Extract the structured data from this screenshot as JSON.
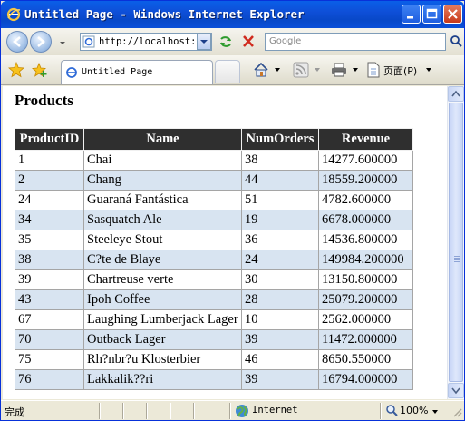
{
  "window": {
    "title": "Untitled Page - Windows Internet Explorer"
  },
  "address_bar": {
    "url": "http://localhost::"
  },
  "search": {
    "placeholder": "Google"
  },
  "tabs": [
    {
      "label": "Untitled Page"
    }
  ],
  "command_bar": {
    "page_label": "页面(P)"
  },
  "page": {
    "heading": "Products",
    "table": {
      "headers": [
        "ProductID",
        "Name",
        "NumOrders",
        "Revenue"
      ],
      "rows": [
        [
          "1",
          "Chai",
          "38",
          "14277.600000"
        ],
        [
          "2",
          "Chang",
          "44",
          "18559.200000"
        ],
        [
          "24",
          "Guaraná Fantástica",
          "51",
          "4782.600000"
        ],
        [
          "34",
          "Sasquatch Ale",
          "19",
          "6678.000000"
        ],
        [
          "35",
          "Steeleye Stout",
          "36",
          "14536.800000"
        ],
        [
          "38",
          "C?te de Blaye",
          "24",
          "149984.200000"
        ],
        [
          "39",
          "Chartreuse verte",
          "30",
          "13150.800000"
        ],
        [
          "43",
          "Ipoh Coffee",
          "28",
          "25079.200000"
        ],
        [
          "67",
          "Laughing Lumberjack Lager",
          "10",
          "2562.000000"
        ],
        [
          "70",
          "Outback Lager",
          "39",
          "11472.000000"
        ],
        [
          "75",
          "Rh?nbr?u Klosterbier",
          "46",
          "8650.550000"
        ],
        [
          "76",
          "Lakkalik??ri",
          "39",
          "16794.000000"
        ]
      ]
    }
  },
  "status_bar": {
    "status": "完成",
    "zone": "Internet",
    "zoom": "100%"
  },
  "colors": {
    "header_bg": "#2f2f2f",
    "alt_row_bg": "#d8e4f1",
    "titlebar": "#0a5fe8"
  },
  "icons": [
    "ie-logo-icon",
    "minimize-icon",
    "maximize-icon",
    "close-icon",
    "back-icon",
    "forward-icon",
    "refresh-icon",
    "stop-icon",
    "search-icon",
    "favorites-star-icon",
    "add-favorites-icon",
    "home-icon",
    "feeds-icon",
    "print-icon",
    "page-icon",
    "globe-icon",
    "zoom-icon",
    "resize-grip-icon"
  ]
}
